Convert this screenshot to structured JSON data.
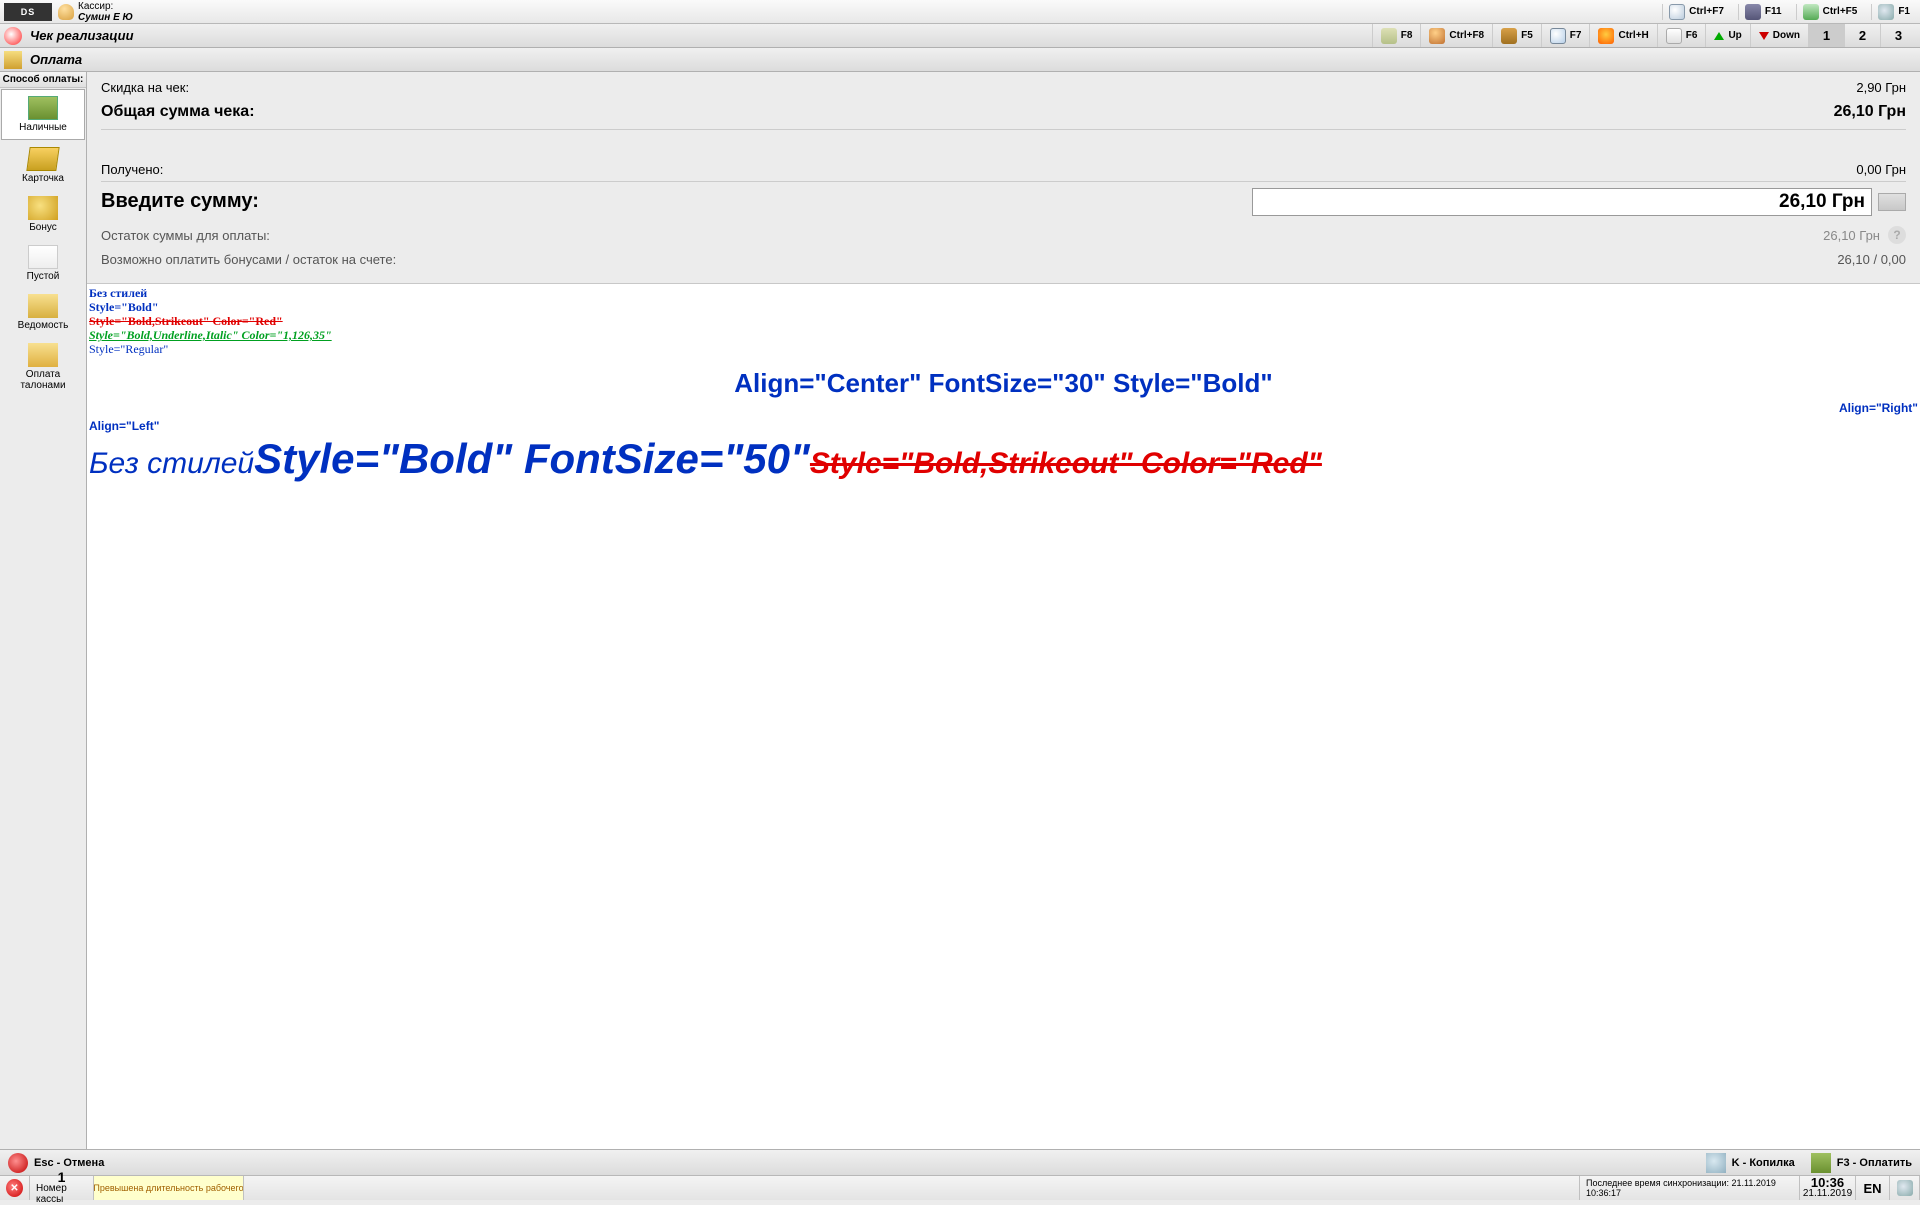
{
  "cashier": {
    "label": "Кассир:",
    "name": "Сумин Е Ю"
  },
  "top_shortcuts": {
    "ctrlF7": "Ctrl+F7",
    "f11": "F11",
    "ctrlF5": "Ctrl+F5",
    "f1": "F1"
  },
  "row2": {
    "title": "Чек реализации",
    "f8": "F8",
    "ctrlF8": "Ctrl+F8",
    "f5": "F5",
    "f7": "F7",
    "ctrlH": "Ctrl+H",
    "f6": "F6",
    "up": "Up",
    "down": "Down",
    "p1": "1",
    "p2": "2",
    "p3": "3"
  },
  "row3": {
    "title": "Оплата"
  },
  "sidebar": {
    "head": "Способ оплаты:",
    "cash": "Наличные",
    "card": "Карточка",
    "bonus": "Бонус",
    "empty": "Пустой",
    "list": "Ведомость",
    "coupon": "Оплата талонами"
  },
  "summary": {
    "discount_label": "Скидка на чек:",
    "discount_value": "2,90 Грн",
    "total_label": "Общая сумма чека:",
    "total_value": "26,10 Грн",
    "got_label": "Получено:",
    "got_value": "0,00 Грн",
    "enter_label": "Введите сумму:",
    "enter_value": "26,10 Грн",
    "rest_label": "Остаток суммы для оплаты:",
    "rest_value": "26,10 Грн",
    "bonus_label": "Возможно оплатить бонусами / остаток на счете:",
    "bonus_value": "26,10 / 0,00"
  },
  "styles_demo": {
    "l1": "Без стилей",
    "l2": "Style=\"Bold\"",
    "l3": "Style=\"Bold,Strikeout\" Color=\"Red\"",
    "l4": "Style=\"Bold,Underline,Italic\" Color=\"1,126,35\"",
    "l5": "Style=\"Regular\"",
    "center": "Align=\"Center\" FontSize=\"30\" Style=\"Bold\"",
    "right": "Align=\"Right\"",
    "left": "Align=\"Left\"",
    "inline1": "Без стилей",
    "inline2": "Style=\"Bold\" FontSize=\"50\"",
    "inline3": "Style=\"Bold,Strikeout\" Color=\"Red\""
  },
  "footer": {
    "esc": "Esc - Отмена",
    "kopilka": "K - Копилка",
    "pay": "F3 - Оплатить"
  },
  "status": {
    "kassa_num": "1",
    "kassa_label": "Номер кассы",
    "warn": "Превышена длительность рабочего",
    "sync": "Последнее время синхронизации: 21.11.2019 10:36:17",
    "time": "10:36",
    "date": "21.11.2019",
    "lang": "EN"
  }
}
